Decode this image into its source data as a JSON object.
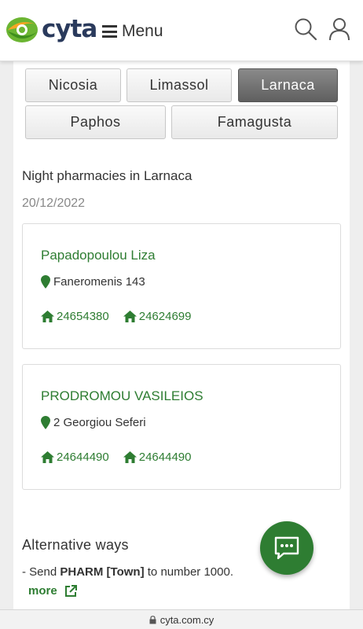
{
  "header": {
    "logo_text": "cyta",
    "menu_label": "Menu"
  },
  "cities": [
    {
      "label": "Nicosia",
      "active": false
    },
    {
      "label": "Limassol",
      "active": false
    },
    {
      "label": "Larnaca",
      "active": true
    },
    {
      "label": "Paphos",
      "active": false
    },
    {
      "label": "Famagusta",
      "active": false
    }
  ],
  "main": {
    "title": "Night pharmacies in Larnaca",
    "date": "20/12/2022"
  },
  "pharmacies": [
    {
      "name": "Papadopoulou Liza",
      "address": "Faneromenis 143",
      "phones": [
        "24654380",
        "24624699"
      ]
    },
    {
      "name": "PRODROMOU VASILEIOS",
      "address": "2 Georgiou Seferi",
      "phones": [
        "24644490",
        "24644490"
      ]
    }
  ],
  "alternative": {
    "title": "Alternative ways",
    "text_prefix": "- Send ",
    "keyword": "PHARM",
    "space": " ",
    "town": "[Town]",
    "text_suffix": " to number 1000.",
    "more_label": "more"
  },
  "urlbar": {
    "url": "cyta.com.cy"
  },
  "colors": {
    "brand_green": "#2e7d32",
    "logo_navy": "#2a3a5c",
    "active_button": "#6e6e6e"
  },
  "icons": [
    "cyta-logo-icon",
    "hamburger-icon",
    "search-icon",
    "user-icon",
    "map-pin-icon",
    "home-phone-icon",
    "external-link-icon",
    "chat-icon",
    "lock-icon"
  ]
}
